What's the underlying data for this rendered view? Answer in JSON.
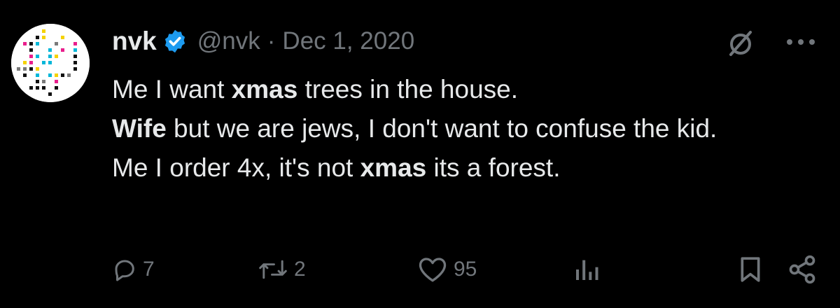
{
  "author": {
    "display_name": "nvk",
    "handle": "@nvk",
    "separator": "·",
    "date": "Dec 1, 2020",
    "verified": true
  },
  "tweet": {
    "line1": {
      "speaker": "Me",
      "pre": " I want ",
      "bold": "xmas",
      "post": " trees in the house."
    },
    "line2": {
      "speaker": "Wife",
      "text": " but we are jews, I don't want to confuse the kid."
    },
    "line3": {
      "speaker": "Me",
      "pre": " I order 4x, it's not ",
      "bold": "xmas",
      "post": " its a forest."
    }
  },
  "actions": {
    "replies": "7",
    "reposts": "2",
    "likes": "95"
  },
  "icons": [
    "grok-icon",
    "more-icon",
    "reply-icon",
    "repost-icon",
    "like-icon",
    "views-icon",
    "bookmark-icon",
    "share-icon",
    "verified-badge-icon"
  ],
  "colors": {
    "background": "#000000",
    "text": "#e7e9ea",
    "muted": "#71767b",
    "verified": "#1d9bf0"
  }
}
